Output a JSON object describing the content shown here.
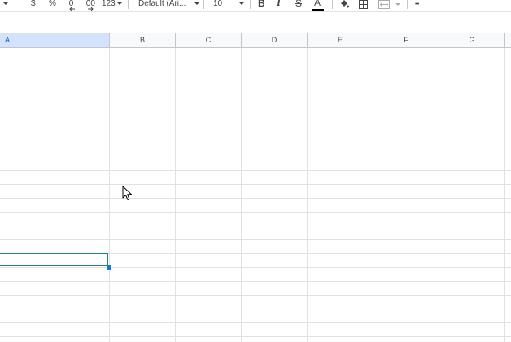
{
  "toolbar": {
    "currency_label": "$",
    "percent_label": "%",
    "decrease_decimal_label": ".0",
    "increase_decimal_label": ".00",
    "number_format_label": "123",
    "font_family_value": "Default (Ari...",
    "font_size_value": "10",
    "bold_label": "B",
    "italic_label": "I",
    "strikethrough_label": "S",
    "text_color_label": "A",
    "text_color": "#000000",
    "fill_icon": "paint-bucket-icon",
    "borders_icon": "borders-icon",
    "merge_icon": "merge-cells-icon",
    "more_label": "•••"
  },
  "columns": [
    {
      "label": "A",
      "active": true
    },
    {
      "label": "B",
      "active": false
    },
    {
      "label": "C",
      "active": false
    },
    {
      "label": "D",
      "active": false
    },
    {
      "label": "E",
      "active": false
    },
    {
      "label": "F",
      "active": false
    },
    {
      "label": "G",
      "active": false
    }
  ],
  "colors": {
    "selection": "#1a73e8",
    "header_bg": "#f8f9fa",
    "grid_line": "#e1e3e1"
  }
}
